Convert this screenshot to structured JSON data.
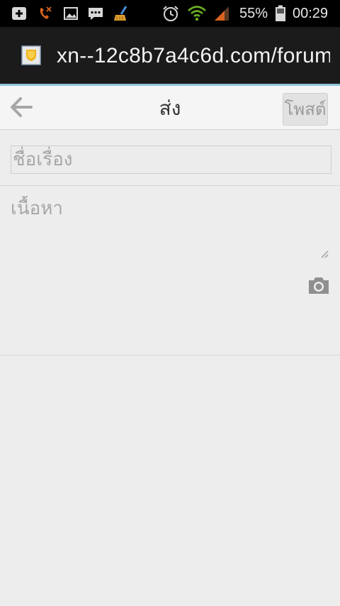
{
  "status_bar": {
    "battery_percent": "55%",
    "time": "00:29",
    "icons": [
      "add-icon",
      "missed-call-icon",
      "image-icon",
      "message-icon",
      "cleaner-icon",
      "alarm-icon",
      "wifi-icon",
      "signal-icon",
      "battery-icon"
    ]
  },
  "browser": {
    "url": "xn--12c8b7a4c6d.com/forum"
  },
  "header": {
    "back_icon": "arrow-left-icon",
    "title": "ส่ง",
    "post_label": "โพสต์"
  },
  "form": {
    "subject_placeholder": "ชื่อเรื่อง",
    "subject_value": "",
    "content_placeholder": "เนื้อหา",
    "content_value": "",
    "camera_icon": "camera-icon"
  },
  "colors": {
    "status_bar": "#000000",
    "url_bar": "#1b1b1b",
    "progress": "#8fc3d8",
    "header_bg": "#f5f5f5",
    "form_bg": "#ededed",
    "placeholder": "#a6a6a6",
    "wifi_signal": "#6ab023",
    "cell_signal": "#d9631e"
  }
}
